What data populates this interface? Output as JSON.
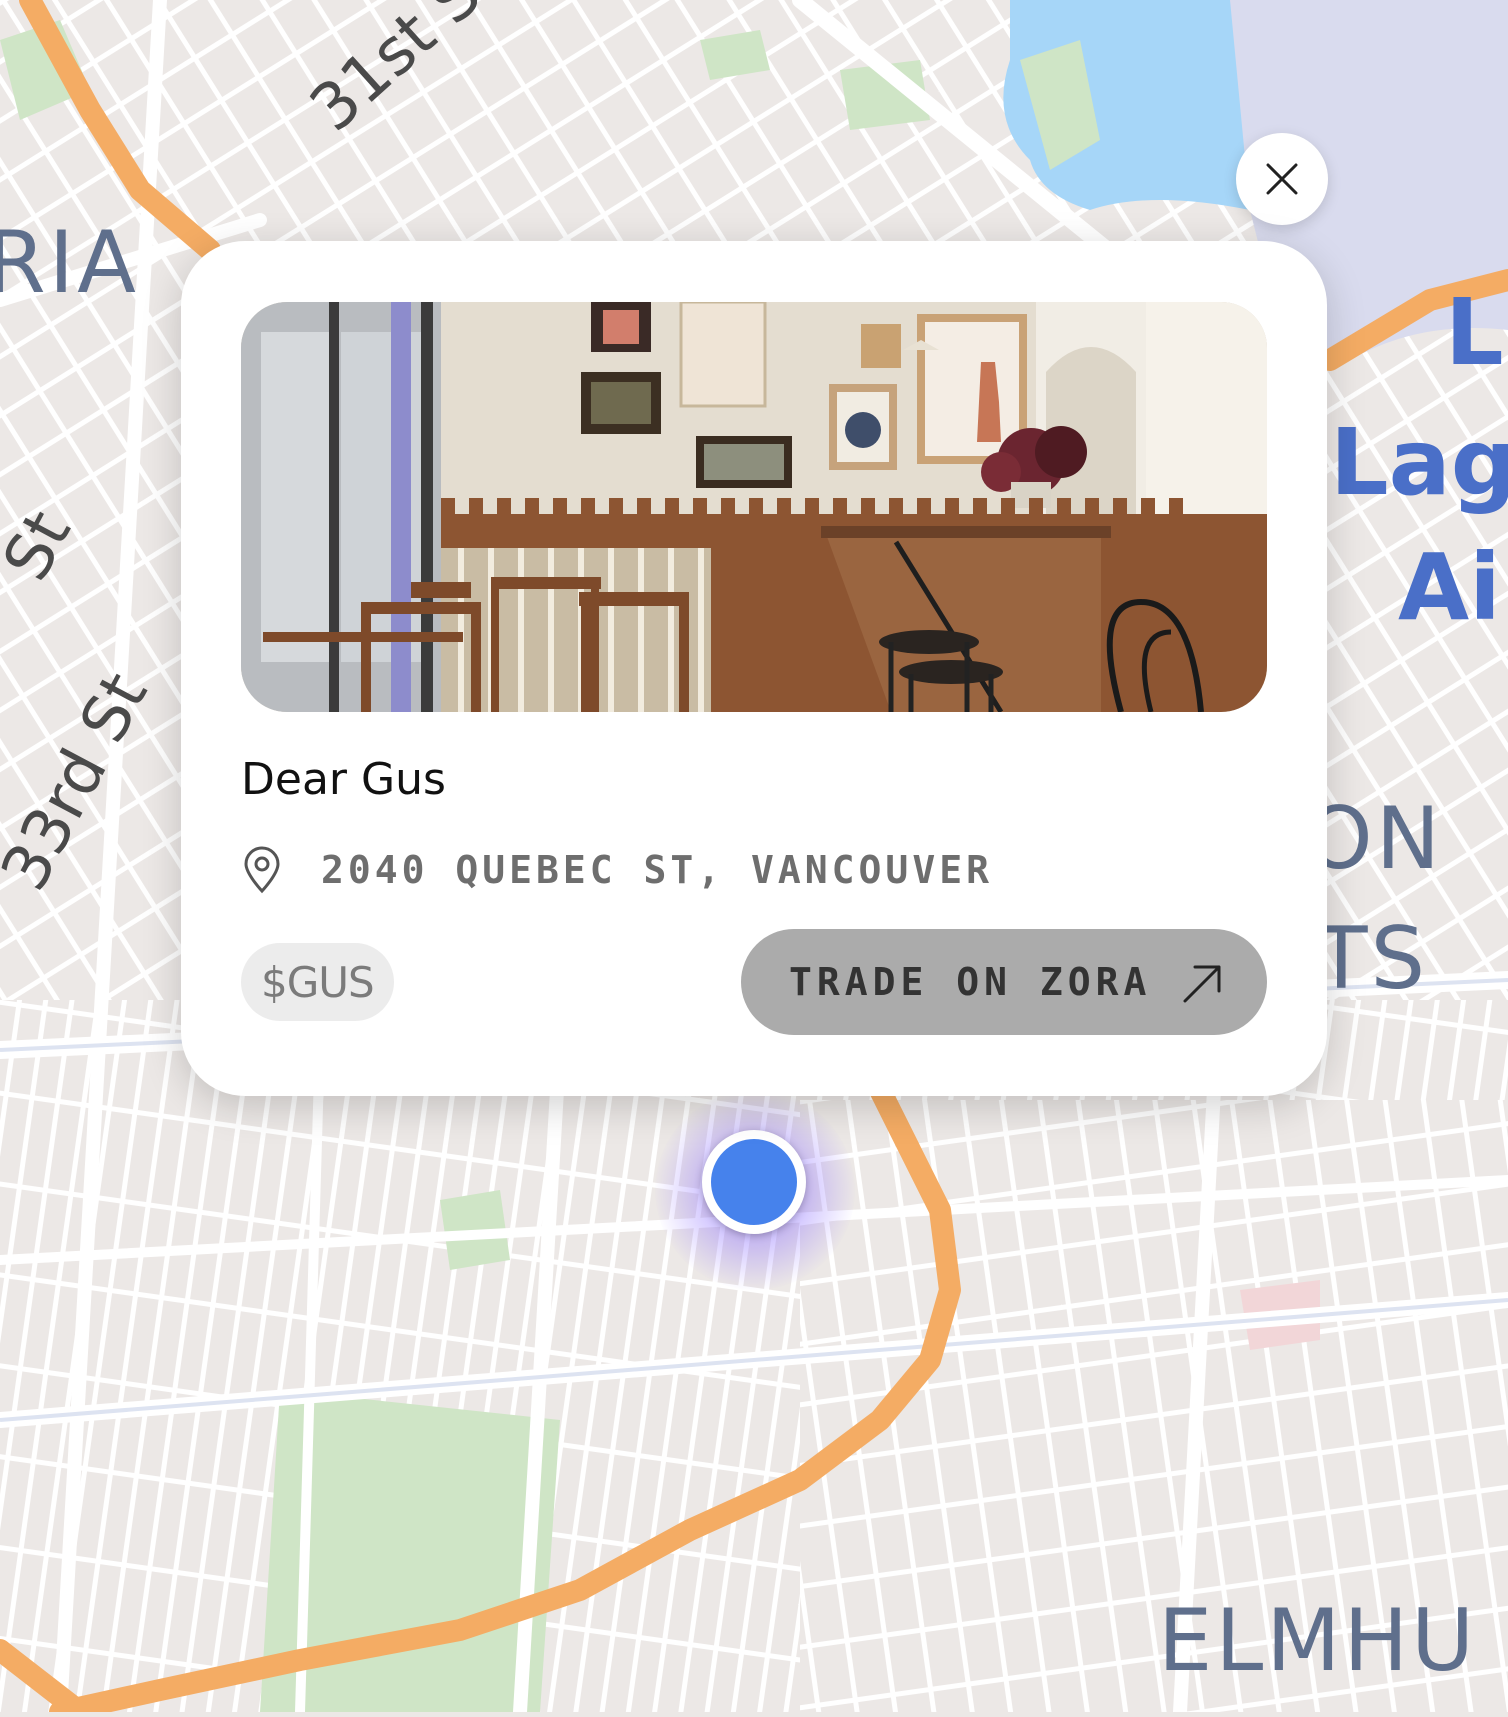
{
  "map": {
    "labels": {
      "street_31st": "31st St",
      "street_33rd": "33rd St",
      "street_st": "St",
      "area_ria": "RIA",
      "area_on": "ON",
      "area_ts": "TS",
      "area_elmhu": "ELMHU",
      "airport_line1": "L",
      "airport_line2": "Lag",
      "airport_line3": "Ai"
    },
    "colors": {
      "land": "#ece8e6",
      "street": "#ffffff",
      "highway": "#f4ac64",
      "park": "#cfe5c6",
      "water": "#a6d6f8",
      "airport": "#d9dbee"
    },
    "user_location": {
      "color": "#4682ec",
      "halo": "#8a6cff"
    }
  },
  "card": {
    "close_icon": "close-icon",
    "photo_alt": "restaurant interior",
    "name": "Dear Gus",
    "address_icon": "location-pin-icon",
    "address": "2040 QUEBEC ST, VANCOUVER",
    "ticker": "$GUS",
    "trade_button": {
      "label": "TRADE ON ZORA",
      "icon": "arrow-up-right-icon"
    }
  }
}
